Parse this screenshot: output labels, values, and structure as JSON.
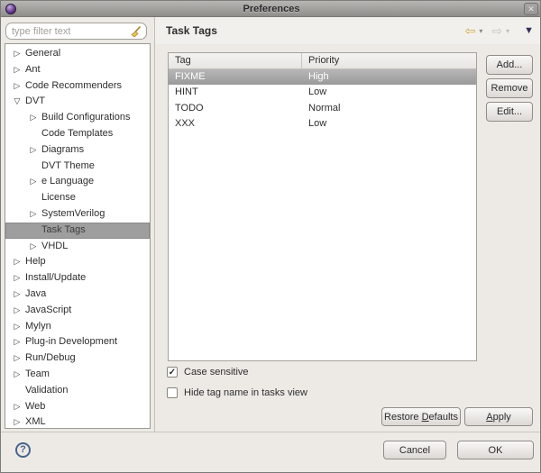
{
  "window": {
    "title": "Preferences"
  },
  "icons": {
    "app": "orb-icon",
    "close": "✕",
    "clear_filter": "broom",
    "collapsed": "▷",
    "expanded": "▽",
    "none": "",
    "back": "⇦",
    "forward": "⇨",
    "menu_arrow": "▾",
    "view_menu": "▼",
    "check": "✓",
    "help": "?"
  },
  "colors": {
    "selection_gray": "#9e9e9e",
    "accent_gold": "#c9a23a",
    "help_blue": "#49648b",
    "view_menu_navy": "#30305c"
  },
  "filter": {
    "placeholder": "type filter text",
    "value": ""
  },
  "sidebar": {
    "tree": [
      {
        "label": "General",
        "arrow": "collapsed",
        "level": 0,
        "selected": false
      },
      {
        "label": "Ant",
        "arrow": "collapsed",
        "level": 0,
        "selected": false
      },
      {
        "label": "Code Recommenders",
        "arrow": "collapsed",
        "level": 0,
        "selected": false
      },
      {
        "label": "DVT",
        "arrow": "expanded",
        "level": 0,
        "selected": false
      },
      {
        "label": "Build Configurations",
        "arrow": "collapsed",
        "level": 1,
        "selected": false
      },
      {
        "label": "Code Templates",
        "arrow": "none",
        "level": 1,
        "selected": false
      },
      {
        "label": "Diagrams",
        "arrow": "collapsed",
        "level": 1,
        "selected": false
      },
      {
        "label": "DVT Theme",
        "arrow": "none",
        "level": 1,
        "selected": false
      },
      {
        "label": "e Language",
        "arrow": "collapsed",
        "level": 1,
        "selected": false
      },
      {
        "label": "License",
        "arrow": "none",
        "level": 1,
        "selected": false
      },
      {
        "label": "SystemVerilog",
        "arrow": "collapsed",
        "level": 1,
        "selected": false
      },
      {
        "label": "Task Tags",
        "arrow": "none",
        "level": 1,
        "selected": true
      },
      {
        "label": "VHDL",
        "arrow": "collapsed",
        "level": 1,
        "selected": false
      },
      {
        "label": "Help",
        "arrow": "collapsed",
        "level": 0,
        "selected": false
      },
      {
        "label": "Install/Update",
        "arrow": "collapsed",
        "level": 0,
        "selected": false
      },
      {
        "label": "Java",
        "arrow": "collapsed",
        "level": 0,
        "selected": false
      },
      {
        "label": "JavaScript",
        "arrow": "collapsed",
        "level": 0,
        "selected": false
      },
      {
        "label": "Mylyn",
        "arrow": "collapsed",
        "level": 0,
        "selected": false
      },
      {
        "label": "Plug-in Development",
        "arrow": "collapsed",
        "level": 0,
        "selected": false
      },
      {
        "label": "Run/Debug",
        "arrow": "collapsed",
        "level": 0,
        "selected": false
      },
      {
        "label": "Team",
        "arrow": "collapsed",
        "level": 0,
        "selected": false
      },
      {
        "label": "Validation",
        "arrow": "none",
        "level": 0,
        "selected": false
      },
      {
        "label": "Web",
        "arrow": "collapsed",
        "level": 0,
        "selected": false
      },
      {
        "label": "XML",
        "arrow": "collapsed",
        "level": 0,
        "selected": false
      }
    ]
  },
  "page": {
    "title": "Task Tags"
  },
  "table": {
    "columns": [
      "Tag",
      "Priority"
    ],
    "rows": [
      {
        "tag": "FIXME",
        "priority": "High",
        "selected": true
      },
      {
        "tag": "HINT",
        "priority": "Low",
        "selected": false
      },
      {
        "tag": "TODO",
        "priority": "Normal",
        "selected": false
      },
      {
        "tag": "XXX",
        "priority": "Low",
        "selected": false
      }
    ]
  },
  "side_buttons": {
    "add": "Add...",
    "remove": "Remove",
    "edit": "Edit..."
  },
  "options": [
    {
      "label": "Case sensitive",
      "checked": true
    },
    {
      "label": "Hide tag name in tasks view",
      "checked": false
    }
  ],
  "footer_panel": {
    "restore_defaults": {
      "pre": "Restore ",
      "mnemonic": "D",
      "post": "efaults"
    },
    "apply": {
      "pre": "",
      "mnemonic": "A",
      "post": "pply"
    }
  },
  "dialog": {
    "help": "?",
    "cancel": "Cancel",
    "ok": "OK"
  }
}
